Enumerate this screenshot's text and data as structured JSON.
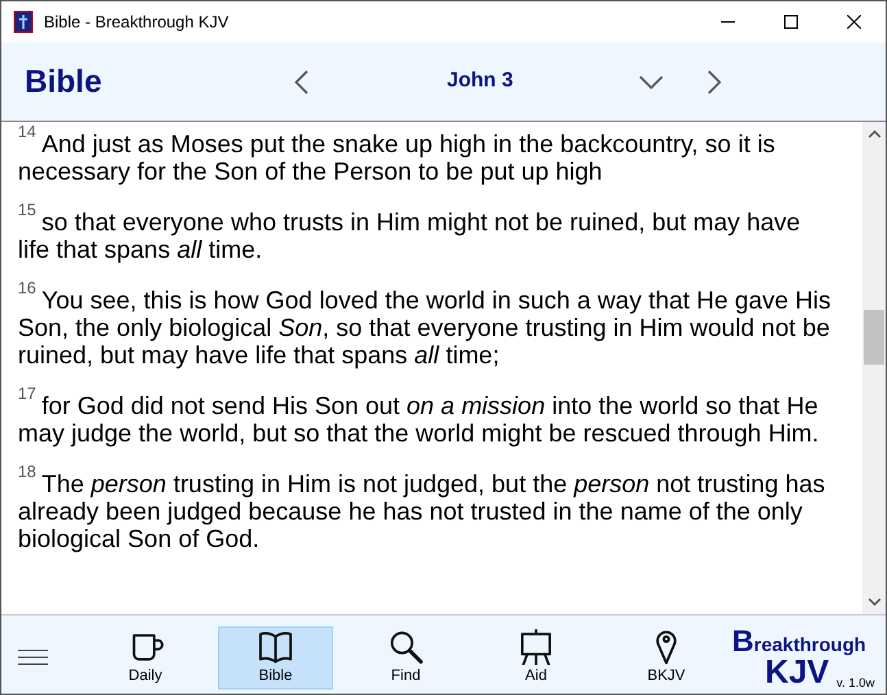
{
  "window": {
    "title": "Bible - Breakthrough KJV"
  },
  "header": {
    "title": "Bible",
    "chapter": "John 3"
  },
  "verses": [
    {
      "number": "14",
      "text": "And just as Moses put the snake up high in the backcountry, so it is necessary for the Son of the Person to be put up high"
    },
    {
      "number": "15",
      "text": "so that everyone who trusts in Him might not be ruined, but may have life that spans *all* time."
    },
    {
      "number": "16",
      "text": "You see, this is how God loved the world in such a way that He gave His Son, the only biological *Son*, so that everyone trusting in Him would not be ruined, but may have life that spans *all* time;"
    },
    {
      "number": "17",
      "text": "for God did not send His Son out *on a mission* into the world so that He may judge the world, but so that the world might be rescued through Him."
    },
    {
      "number": "18",
      "text": "The *person* trusting in Him is not judged, but the *person* not trusting has already been judged because he has not trusted in the name of the only biological Son of God."
    }
  ],
  "nav": [
    {
      "kind": "cup",
      "label": "Daily",
      "selected": false
    },
    {
      "kind": "book",
      "label": "Bible",
      "selected": true
    },
    {
      "kind": "magnifier",
      "label": "Find",
      "selected": false
    },
    {
      "kind": "easel",
      "label": "Aid",
      "selected": false
    },
    {
      "kind": "pin",
      "label": "BKJV",
      "selected": false
    }
  ],
  "logo": {
    "initial": "B",
    "rest": "reakthrough",
    "line2": "KJV",
    "version": "v. 1.0w"
  }
}
